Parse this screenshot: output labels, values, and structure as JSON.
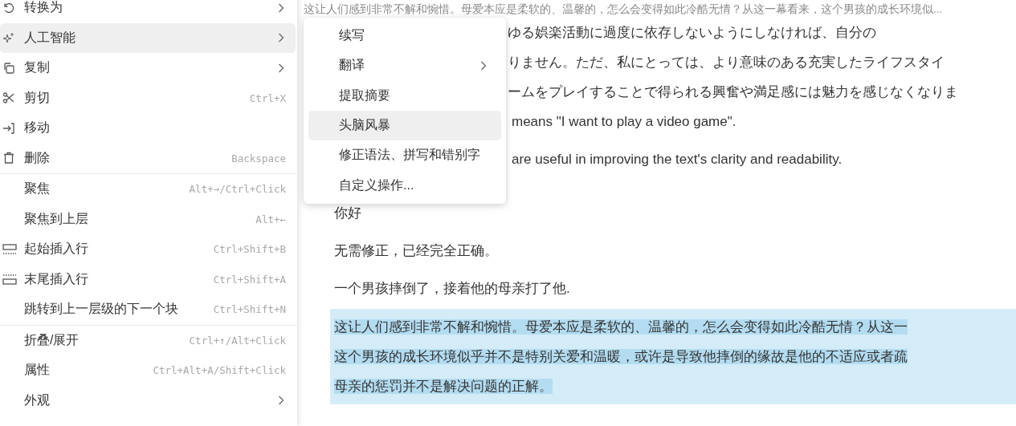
{
  "context_menu": {
    "sections": [
      {
        "items": [
          {
            "label": "转换为",
            "submenu": true,
            "selected": false
          },
          {
            "label": "人工智能",
            "submenu": true,
            "selected": true
          },
          {
            "label": "复制",
            "submenu": true,
            "selected": false
          },
          {
            "label": "剪切",
            "shortcut": "Ctrl+X",
            "submenu": false,
            "selected": false
          },
          {
            "label": "移动",
            "submenu": false,
            "selected": false
          },
          {
            "label": "删除",
            "shortcut": "Backspace",
            "submenu": false,
            "selected": false
          }
        ]
      },
      {
        "items": [
          {
            "label": "聚焦",
            "shortcut": "Alt+→/Ctrl+Click",
            "submenu": false,
            "selected": false
          },
          {
            "label": "聚焦到上层",
            "shortcut": "Alt+←",
            "submenu": false,
            "selected": false
          },
          {
            "label": "起始插入行",
            "shortcut": "Ctrl+Shift+B",
            "submenu": false,
            "selected": false
          },
          {
            "label": "末尾插入行",
            "shortcut": "Ctrl+Shift+A",
            "submenu": false,
            "selected": false
          },
          {
            "label": "跳转到上一层级的下一个块",
            "shortcut": "Ctrl+Shift+N",
            "submenu": false,
            "selected": false
          }
        ]
      },
      {
        "items": [
          {
            "label": "折叠/展开",
            "shortcut": "Ctrl+↑/Alt+Click",
            "submenu": false,
            "selected": false
          },
          {
            "label": "属性",
            "shortcut": "Ctrl+Alt+A/Shift+Click",
            "submenu": false,
            "selected": false
          },
          {
            "label": "外观",
            "submenu": true,
            "selected": false
          }
        ]
      }
    ]
  },
  "ai_submenu": {
    "items": [
      {
        "label": "续写",
        "submenu": false,
        "selected": false
      },
      {
        "label": "翻译",
        "submenu": true,
        "selected": false
      },
      {
        "label": "提取摘要",
        "submenu": false,
        "selected": false
      },
      {
        "label": "头脑风暴",
        "submenu": false,
        "selected": true
      },
      {
        "label": "修正语法、拼写和错别字",
        "submenu": false,
        "selected": false
      },
      {
        "label": "自定义操作...",
        "submenu": false,
        "selected": false
      }
    ]
  },
  "document": {
    "header": "这让人们感到非常不解和惋惜。母爱本应是柔软的、温馨的，怎么会变得如此冷酷无情？从这一幕看来，这个男孩的成长环境似...",
    "partial_lines": [
      "ゆる娯楽活動に過度に依存しないようにしなければ、自分の",
      "りません。ただ、私にとっては、より意味のある充実したライフスタイ",
      "ームをプレイすることで得られる興奮や満足感には魅力を感じなくなりま",
      "means \"I want to play a video game\".",
      "are useful in improving the text's clarity and readability."
    ],
    "paragraphs": [
      "你好",
      "无需修正，已经完全正确。",
      "一个男孩摔倒了，接着他的母亲打了他."
    ],
    "selected_paragraph": {
      "selected": true,
      "lines": [
        "这让人们感到非常不解和惋惜。母爱本应是柔软的、温馨的，怎么会变得如此冷酷无情？从这一",
        "这个男孩的成长环境似乎并不是特别关爱和温暖，或许是导致他摔倒的缘故是他的不适应或者疏",
        "母亲的惩罚并不是解决问题的正解。"
      ]
    }
  }
}
